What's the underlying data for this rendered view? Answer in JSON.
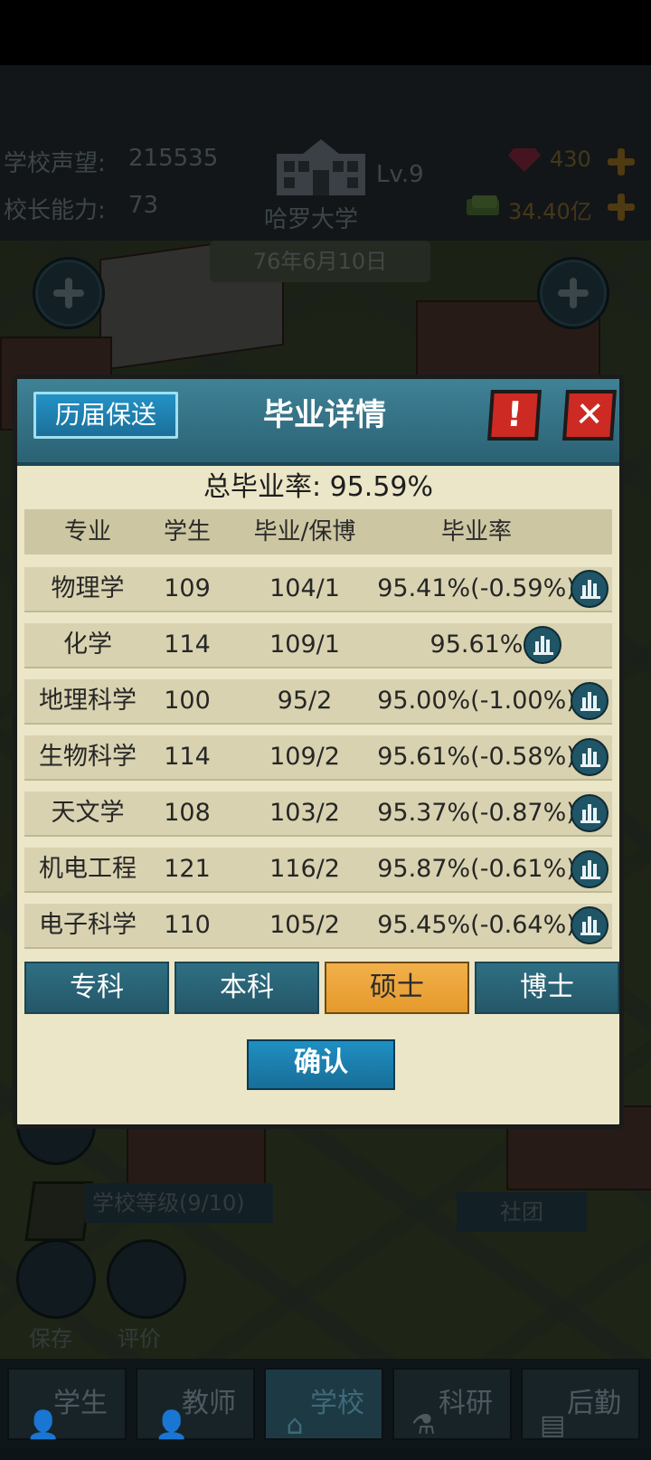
{
  "hud": {
    "reputation_label": "学校声望:",
    "reputation_value": "215535",
    "principal_label": "校长能力:",
    "principal_value": "73",
    "school_name": "哈罗大学",
    "level": "Lv.9",
    "gems": "430",
    "money": "34.40亿",
    "date": "76年6月10日"
  },
  "dialog": {
    "history_button": "历届保送",
    "title": "毕业详情",
    "warn_icon": "exclamation-icon",
    "close_icon": "close-icon",
    "total_rate": "总毕业率: 95.59%",
    "columns": {
      "major": "专业",
      "students": "学生",
      "grad": "毕业/保博",
      "rate": "毕业率"
    },
    "rows": [
      {
        "major": "物理学",
        "students": "109",
        "grad": "104/1",
        "rate": "95.41%",
        "delta": "(-0.59%)"
      },
      {
        "major": "化学",
        "students": "114",
        "grad": "109/1",
        "rate": "95.61%",
        "delta": ""
      },
      {
        "major": "地理科学",
        "students": "100",
        "grad": "95/2",
        "rate": "95.00%",
        "delta": "(-1.00%)"
      },
      {
        "major": "生物科学",
        "students": "114",
        "grad": "109/2",
        "rate": "95.61%",
        "delta": "(-0.58%)"
      },
      {
        "major": "天文学",
        "students": "108",
        "grad": "103/2",
        "rate": "95.37%",
        "delta": "(-0.87%)"
      },
      {
        "major": "机电工程",
        "students": "121",
        "grad": "116/2",
        "rate": "95.87%",
        "delta": "(-0.61%)"
      },
      {
        "major": "电子科学",
        "students": "110",
        "grad": "105/2",
        "rate": "95.45%",
        "delta": "(-0.64%)"
      }
    ],
    "tabs": [
      "专科",
      "本科",
      "硕士",
      "博士"
    ],
    "active_tab": "硕士",
    "confirm": "确认"
  },
  "bottom": {
    "school_level": "学校等级(9/10)",
    "club": "社团",
    "save": "保存",
    "review": "评价"
  },
  "nav": [
    "学生",
    "教师",
    "学校",
    "科研",
    "后勤"
  ],
  "nav_active": "学校",
  "colors": {
    "dialog_bg": "#ebe6c7",
    "header": "#2b6275",
    "delta_orange": "#e27a1d",
    "active_tab": "#f2b04a",
    "close_red": "#cc2a23"
  }
}
